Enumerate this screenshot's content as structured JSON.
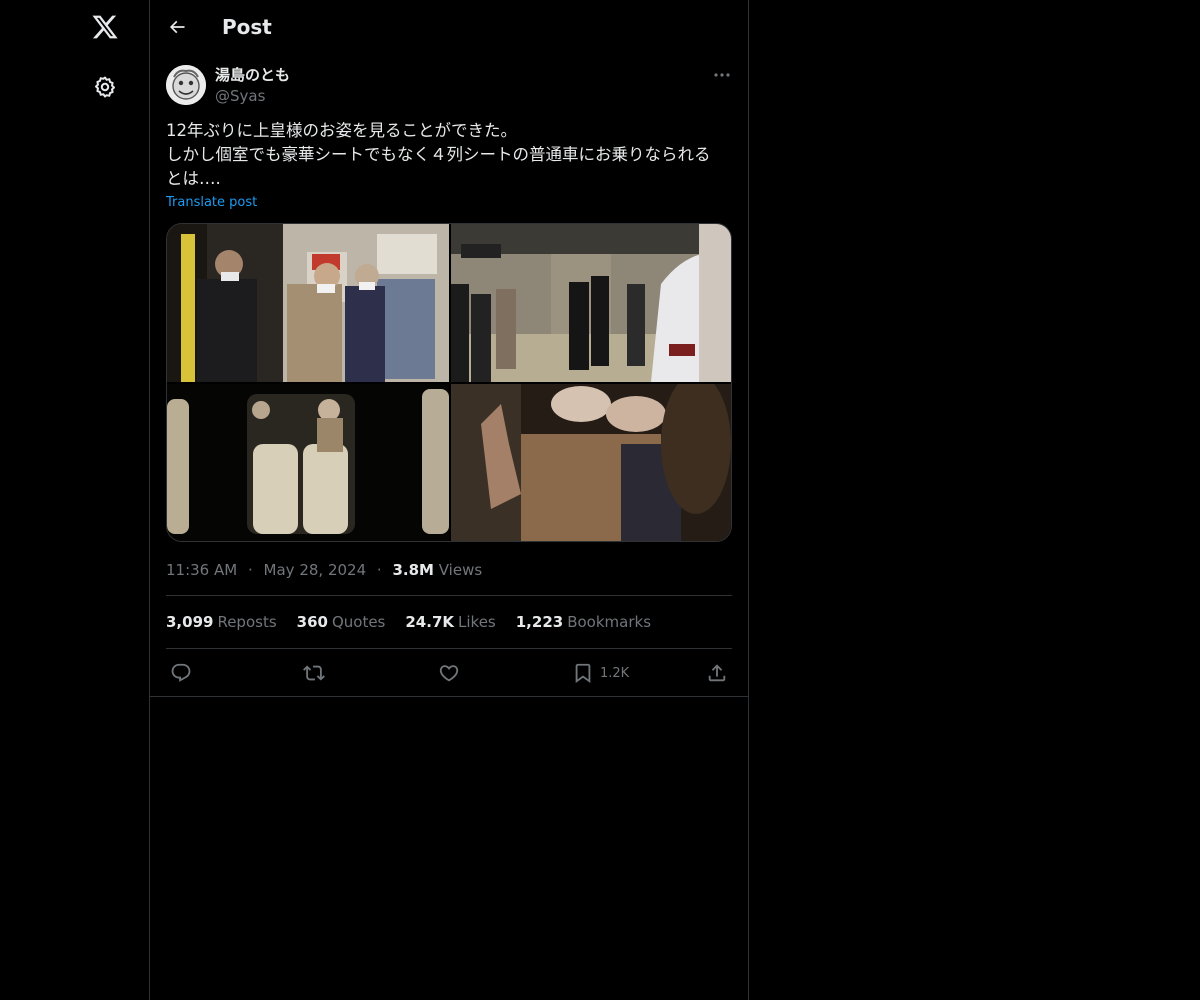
{
  "nav": {
    "logo_icon": "x-logo-icon",
    "settings_icon": "gear-icon"
  },
  "header": {
    "title": "Post",
    "back_icon": "arrow-left-icon"
  },
  "post": {
    "author": {
      "display_name": "湯島のとも",
      "handle": "@Syas"
    },
    "text_lines": [
      "12年ぶりに上皇様のお姿を見ることができた。",
      "しかし個室でも豪華シートでもなく４列シートの普通車にお乗りなられる",
      "とは…."
    ],
    "translate_label": "Translate post",
    "time": "11:36 AM",
    "date": "May 28, 2024",
    "views_count": "3.8M",
    "views_label": "Views",
    "separator": "·",
    "stats": {
      "reposts": {
        "count": "3,099",
        "label": "Reposts"
      },
      "quotes": {
        "count": "360",
        "label": "Quotes"
      },
      "likes": {
        "count": "24.7K",
        "label": "Likes"
      },
      "bookmarks": {
        "count": "1,223",
        "label": "Bookmarks"
      }
    },
    "actions": {
      "reply_icon": "speech-bubble-icon",
      "repost_icon": "repost-arrows-icon",
      "like_icon": "heart-icon",
      "bookmark_icon": "bookmark-icon",
      "bookmark_count": "1.2K",
      "share_icon": "share-upload-icon"
    },
    "media": [
      {
        "description": "photo-station-aed"
      },
      {
        "description": "photo-station-platform"
      },
      {
        "description": "photo-train-window-seats"
      },
      {
        "description": "photo-waving-hand"
      }
    ]
  },
  "colors": {
    "background": "#000000",
    "text_primary": "#e7e9ea",
    "text_secondary": "#71767b",
    "link": "#1d9bf0",
    "border": "#2f3336"
  }
}
